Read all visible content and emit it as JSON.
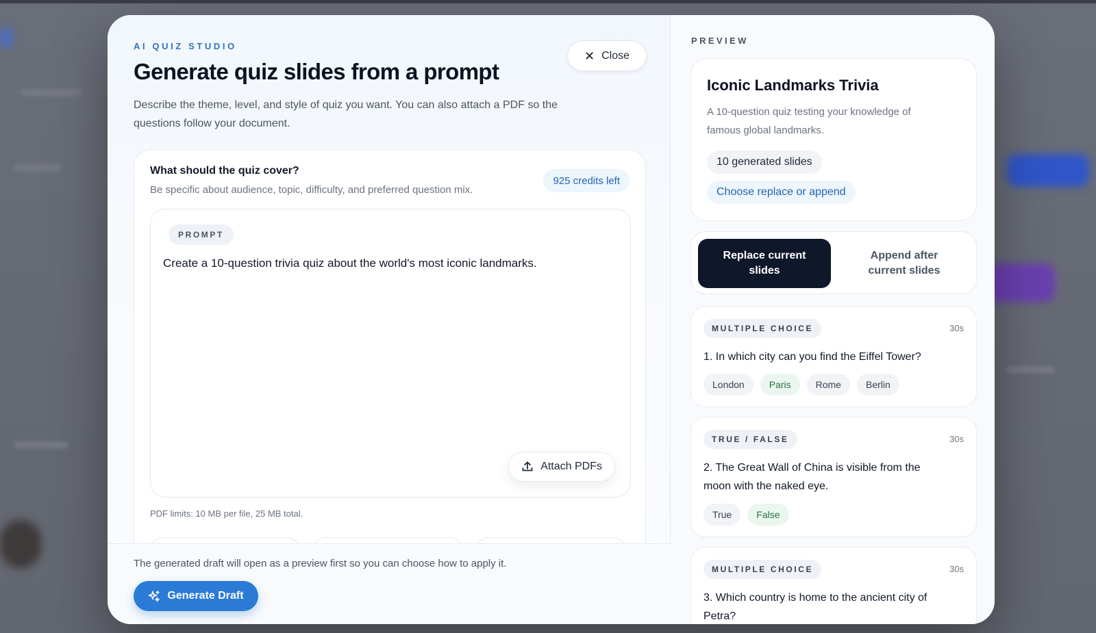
{
  "theme": {
    "accent": "#2b7bd6",
    "dark": "#0f172a",
    "correct_bg": "#eaf7ef"
  },
  "left": {
    "eyebrow": "AI QUIZ STUDIO",
    "title": "Generate quiz slides from a prompt",
    "subtitle": "Describe the theme, level, and style of quiz you want. You can also attach a PDF so the questions follow your document.",
    "close_label": "Close",
    "card": {
      "question": "What should the quiz cover?",
      "hint": "Be specific about audience, topic, difficulty, and preferred question mix.",
      "credits": "925 credits left",
      "prompt_tag": "PROMPT",
      "prompt_value": "Create a 10-question trivia quiz about the world's most iconic landmarks.",
      "attach_label": "Attach PDFs",
      "pdf_limits": "PDF limits: 10 MB per file, 25 MB total."
    },
    "footer": {
      "note": "The generated draft will open as a preview first so you can choose how to apply it.",
      "generate_label": "Generate Draft"
    }
  },
  "preview": {
    "label": "PREVIEW",
    "summary": {
      "title": "Iconic Landmarks Trivia",
      "description": "A 10-question quiz testing your knowledge of famous global landmarks.",
      "slides_count": "10 generated slides",
      "choose_hint": "Choose replace or append"
    },
    "mode": {
      "replace": "Replace current slides",
      "append": "Append after current slides",
      "selected": "replace"
    },
    "questions": [
      {
        "type": "MULTIPLE CHOICE",
        "time": "30s",
        "text": "1. In which city can you find the Eiffel Tower?",
        "options": [
          "London",
          "Paris",
          "Rome",
          "Berlin"
        ],
        "correct": "Paris"
      },
      {
        "type": "TRUE / FALSE",
        "time": "30s",
        "text": "2. The Great Wall of China is visible from the moon with the naked eye.",
        "options": [
          "True",
          "False"
        ],
        "correct": "False"
      },
      {
        "type": "MULTIPLE CHOICE",
        "time": "30s",
        "text": "3. Which country is home to the ancient city of Petra?"
      }
    ]
  }
}
